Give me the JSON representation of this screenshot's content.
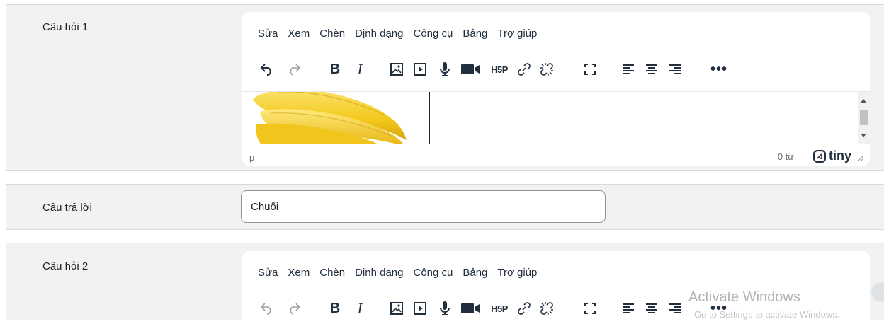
{
  "question1": {
    "label": "Câu hỏi 1",
    "menu": [
      "Sửa",
      "Xem",
      "Chèn",
      "Định dạng",
      "Công cụ",
      "Bảng",
      "Trợ giúp"
    ],
    "toolbar": {
      "bold": "B",
      "italic": "I",
      "h5p": "H5P",
      "more": "•••"
    },
    "status": {
      "path": "p",
      "word_count": "0 từ",
      "brand": "tiny"
    },
    "content_image": "banana"
  },
  "answer1": {
    "label": "Câu trả lời",
    "value": "Chuối"
  },
  "question2": {
    "label": "Câu hỏi 2",
    "menu": [
      "Sửa",
      "Xem",
      "Chèn",
      "Định dạng",
      "Công cụ",
      "Bảng",
      "Trợ giúp"
    ],
    "toolbar": {
      "bold": "B",
      "italic": "I",
      "h5p": "H5P",
      "more": "•••"
    }
  },
  "watermark": {
    "title": "Activate Windows",
    "subtitle": "Go to Settings to activate Windows."
  },
  "colors": {
    "panel_bg": "#f2f2f2",
    "toolbar_icon": "#222f3e",
    "border": "#d9d9d9"
  }
}
